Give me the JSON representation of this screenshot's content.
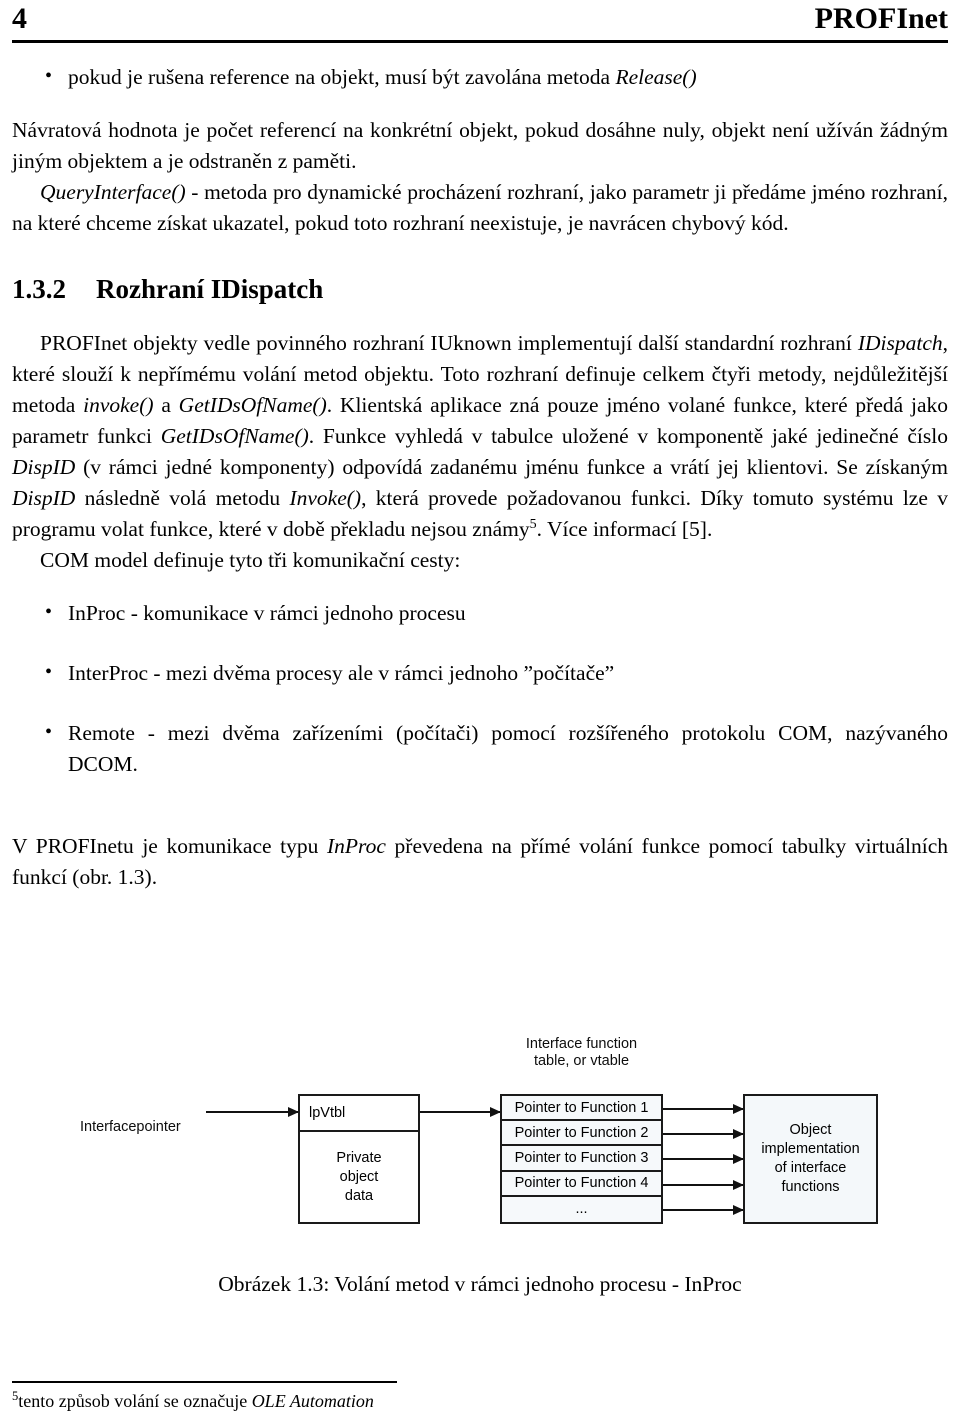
{
  "header": {
    "folio": "4",
    "title": "PROFInet"
  },
  "body": {
    "bullet_release": {
      "bullet": "•",
      "text_before": "pokud je rušena reference na objekt, musí být zavolána metoda ",
      "italic": "Release()"
    },
    "para_navratova": "Návratová hodnota je počet referencí na konkrétní objekt, pokud dosáhne nuly, objekt není užíván žádným jiným objektem a je odstraněn z paměti.",
    "para_query": {
      "italic1": "QueryInterface()",
      "rest": " - metoda pro dynamické procházení rozhraní, jako parametr ji předáme jméno rozhraní, na které chceme získat ukazatel, pokud toto rozhraní neexistuje, je navrácen chybový kód."
    },
    "section": {
      "number": "1.3.2",
      "title": "Rozhraní IDispatch"
    },
    "para_dispatch": {
      "s1": "PROFInet objekty vedle povinného rozhraní IUknown implementují další standardní rozhraní ",
      "i1": "IDispatch",
      "s2": ", které slouží k nepřímému volání metod objektu. Toto rozhraní definuje celkem čtyři metody, nejdůležitější metoda ",
      "i2": "invoke()",
      "s3": " a ",
      "i3": "GetIDsOfName()",
      "s4": ". Klientská aplikace zná pouze jméno volané funkce, které předá jako parametr funkci ",
      "i4": "GetIDsOfName()",
      "s5": ". Funkce vyhledá v tabulce uložené v komponentě jaké jedinečné číslo ",
      "i5": "DispID",
      "s6": " (v rámci jedné komponenty) odpovídá zadanému jménu funkce a vrátí jej klientovi. Se získaným ",
      "i6": "DispID",
      "s7": " následně volá metodu ",
      "i7": "Invoke()",
      "s8": ", která provede požadovanou funkci. Díky tomuto systému lze v programu volat funkce, které v době překladu nejsou známy",
      "footnote_marker": "5",
      "s9": ". Více informací [5]."
    },
    "para_com": "COM model definuje tyto tři komunikační cesty:",
    "com_bullets": [
      "InProc - komunikace v rámci jednoho procesu",
      "InterProc - mezi dvěma procesy ale v rámci jednoho ”počítače”",
      "Remote - mezi dvěma zařízeními (počítači) pomocí rozšířeného protokolu COM, nazývaného DCOM."
    ],
    "bullet_char": "•",
    "para_profinetu": {
      "s1": "V PROFInetu je komunikace typu ",
      "i1": "InProc",
      "s2": " převedena na přímé volání funkce pomocí tabulky virtuálních funkcí (obr. 1.3)."
    }
  },
  "figure": {
    "vtable_title_line1": "Interface function",
    "vtable_title_line2": "table, or vtable",
    "interfacepointer_label": "Interfacepointer",
    "vtbl_box": {
      "slot_label": "lpVtbl",
      "body_line1": "Private",
      "body_line2": "object",
      "body_line3": "data"
    },
    "vtable_rows": [
      "Pointer to Function 1",
      "Pointer to Function 2",
      "Pointer to Function 3",
      "Pointer to Function 4",
      "..."
    ],
    "object_box": {
      "line1": "Object",
      "line2": "implementation",
      "line3": "of interface",
      "line4": "functions"
    },
    "caption": "Obrázek 1.3: Volání metod v rámci jednoho procesu - InProc"
  },
  "footnote": {
    "marker": "5",
    "text": "tento způsob volání se označuje ",
    "italic": "OLE Automation"
  }
}
